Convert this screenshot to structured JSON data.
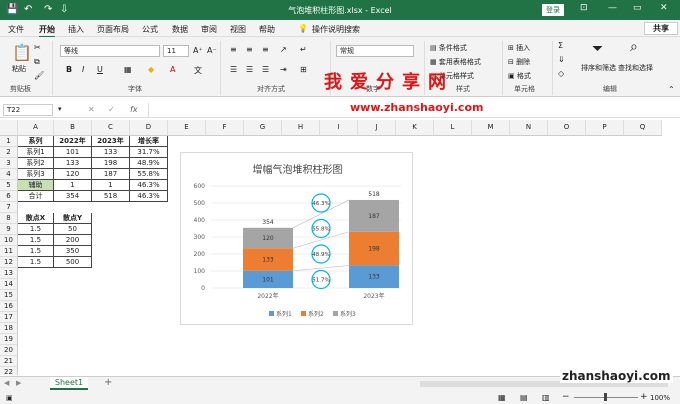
{
  "titlebar": {
    "title": "气泡堆积柱形图.xlsx  -  Excel",
    "login": "登录",
    "minimize": "—",
    "restore": "▭",
    "close": "✕"
  },
  "menu": {
    "items": [
      "文件",
      "开始",
      "插入",
      "页面布局",
      "公式",
      "数据",
      "审阅",
      "视图",
      "帮助"
    ],
    "search": "操作说明搜索",
    "share": "共享"
  },
  "ribbon": {
    "paste": "粘贴",
    "clipboard": "剪贴板",
    "font_name": "等线",
    "font_size": "11",
    "font_group": "字体",
    "align_group": "对齐方式",
    "number_format": "常规",
    "number_group": "数字",
    "cond_format": "条件格式",
    "table_format": "套用表格格式",
    "cell_style": "单元格样式",
    "style_group": "样式",
    "insert": "插入",
    "delete": "删除",
    "format": "格式",
    "cells_group": "单元格",
    "sort_filter": "排序和筛选",
    "find_select": "查找和选择",
    "edit_group": "编辑"
  },
  "watermark": {
    "line1": "我爱分享网",
    "line2": "www.zhanshaoyi.com",
    "corner": "zhanshaoyi.com"
  },
  "formula_bar": {
    "name_box": "T22",
    "fx": "fx",
    "formula": ""
  },
  "columns": [
    "A",
    "B",
    "C",
    "D",
    "E",
    "F",
    "G",
    "H",
    "I",
    "J",
    "K",
    "L",
    "M",
    "N",
    "O",
    "P",
    "Q"
  ],
  "rows": [
    "1",
    "2",
    "3",
    "4",
    "5",
    "6",
    "7",
    "8",
    "9",
    "10",
    "11",
    "12",
    "13",
    "14",
    "15",
    "16",
    "17",
    "18",
    "19",
    "20",
    "21",
    "22"
  ],
  "table1": {
    "headers": [
      "系列",
      "2022年",
      "2023年",
      "增长率"
    ],
    "rows": [
      [
        "系列1",
        "101",
        "133",
        "31.7%"
      ],
      [
        "系列2",
        "133",
        "198",
        "48.9%"
      ],
      [
        "系列3",
        "120",
        "187",
        "55.8%"
      ],
      [
        "辅助",
        "1",
        "1",
        "46.3%"
      ],
      [
        "合计",
        "354",
        "518",
        "46.3%"
      ]
    ]
  },
  "table2": {
    "headers": [
      "散点X",
      "散点Y"
    ],
    "rows": [
      [
        "1.5",
        "50"
      ],
      [
        "1.5",
        "200"
      ],
      [
        "1.5",
        "350"
      ],
      [
        "1.5",
        "500"
      ]
    ]
  },
  "chart_data": {
    "type": "bar",
    "title": "增幅气泡堆积柱形图",
    "categories": [
      "2022年",
      "2023年"
    ],
    "series": [
      {
        "name": "系列1",
        "values": [
          101,
          133
        ],
        "color": "#5b9bd5"
      },
      {
        "name": "系列2",
        "values": [
          133,
          198
        ],
        "color": "#ed7d31"
      },
      {
        "name": "系列3",
        "values": [
          120,
          187
        ],
        "color": "#a5a5a5"
      }
    ],
    "totals": [
      354,
      518
    ],
    "bubbles": [
      {
        "label": "51.7%",
        "y": 50
      },
      {
        "label": "48.9%",
        "y": 200
      },
      {
        "label": "55.8%",
        "y": 350
      },
      {
        "label": "46.3%",
        "y": 500
      }
    ],
    "yticks": [
      "0",
      "100",
      "200",
      "300",
      "400",
      "500",
      "600"
    ],
    "ylim": [
      0,
      600
    ],
    "legend": "bottom",
    "grid": true
  },
  "status": {
    "sheet_tab": "Sheet1",
    "add_sheet": "+",
    "zoom": "100%"
  }
}
